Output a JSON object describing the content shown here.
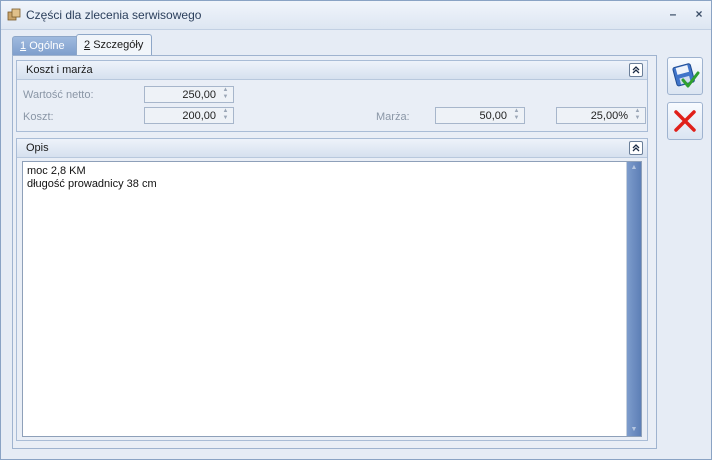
{
  "window": {
    "title": "Części dla zlecenia serwisowego",
    "minimize_glyph": "–",
    "close_glyph": "×"
  },
  "tabs": [
    {
      "label": "Ogólne",
      "hotkey": "1",
      "active": false
    },
    {
      "label": "Szczegóły",
      "hotkey": "2",
      "active": true
    }
  ],
  "cost_group": {
    "title": "Koszt i marża",
    "net_value": {
      "label": "Wartość netto:",
      "value": "250,00"
    },
    "cost": {
      "label": "Koszt:",
      "value": "200,00"
    },
    "margin": {
      "label": "Marża:",
      "value": "50,00",
      "percent": "25,00%"
    }
  },
  "description_group": {
    "title": "Opis",
    "lines": [
      "moc 2,8 KM",
      "długość prowadnicy 38 cm"
    ]
  },
  "icons": {
    "app": "parts-box-icon",
    "save": "save-disk-check-icon",
    "cancel": "cancel-x-icon",
    "collapse": "chevron-double-up-icon"
  },
  "colors": {
    "cancel_red": "#e0201a",
    "save_blue": "#2a5fb8",
    "save_green": "#2fa02f"
  }
}
